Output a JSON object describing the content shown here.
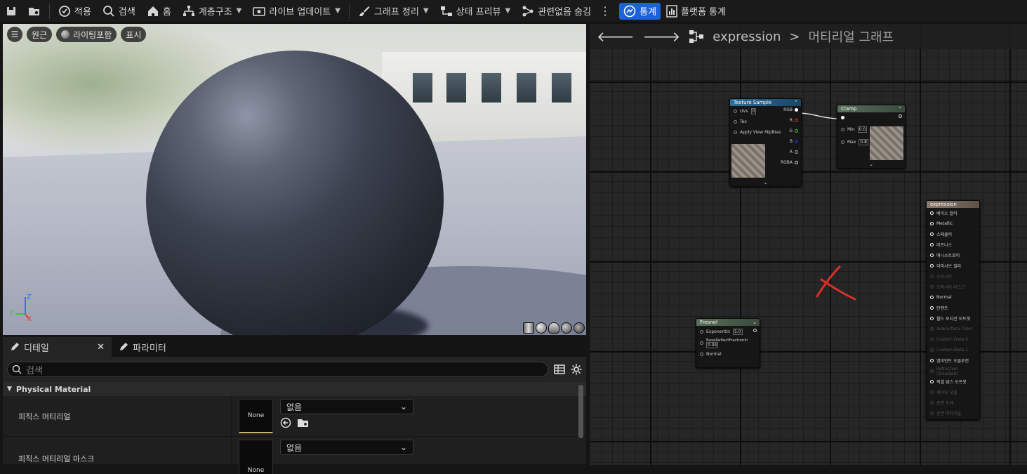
{
  "toolbar": {
    "apply": "적용",
    "search": "검색",
    "home": "홈",
    "hierarchy": "계층구조",
    "live_update": "라이브 업데이트",
    "graph_cleanup": "그래프 정리",
    "state_preview": "상태 프리뷰",
    "hide_unrelated": "관련없음 숨김",
    "stats": "통계",
    "platform_stats": "플랫폼 통계"
  },
  "viewport": {
    "perspective": "원근",
    "lighting": "라이팅포함",
    "show": "표시",
    "axis_z": "Z",
    "axis_y": "Y",
    "axis_x": "X"
  },
  "details": {
    "tab_details": "디테일",
    "tab_params": "파라미터",
    "search_placeholder": "검색",
    "section": "Physical Material",
    "rows": [
      {
        "label": "피직스 머티리얼",
        "thumb": "None",
        "value": "없음"
      },
      {
        "label": "피직스 머티리얼 마스크",
        "thumb": "None",
        "value": "없음"
      }
    ]
  },
  "graph": {
    "crumb_root": "expression",
    "crumb_sep": ">",
    "crumb_leaf": "머티리얼 그래프",
    "texture_sample": {
      "title": "Texture Sample",
      "inputs": [
        "UVs",
        "Tex",
        "Apply View MipBias"
      ],
      "uv_value": "0",
      "outputs": [
        "RGB",
        "R",
        "G",
        "B",
        "A",
        "RGBA"
      ]
    },
    "clamp": {
      "title": "Clamp",
      "min_label": "Min",
      "min_value": "0.0",
      "max_label": "Max",
      "max_value": "0.8"
    },
    "fresnel": {
      "title": "Fresnel",
      "exp_label": "ExponentIn",
      "exp_value": "5.0",
      "base_label": "BaseReflectFractionIn",
      "base_value": "0.04",
      "normal_label": "Normal"
    },
    "result": {
      "title": "expression",
      "pins": [
        {
          "label": "베이스 컬러",
          "active": true
        },
        {
          "label": "Metallic",
          "active": true
        },
        {
          "label": "스페큘러",
          "active": true
        },
        {
          "label": "러프니스",
          "active": true
        },
        {
          "label": "애니소트로피",
          "active": true
        },
        {
          "label": "이미시브 컬러",
          "active": true
        },
        {
          "label": "오파시티",
          "active": false
        },
        {
          "label": "오파시티 마스크",
          "active": false
        },
        {
          "label": "Normal",
          "active": true
        },
        {
          "label": "탄젠트",
          "active": true
        },
        {
          "label": "월드 포지션 오프셋",
          "active": true
        },
        {
          "label": "Subsurface Color",
          "active": false
        },
        {
          "label": "Custom Data 0",
          "active": false
        },
        {
          "label": "Custom Data 1",
          "active": false
        },
        {
          "label": "앰비언트 오클루전",
          "active": true
        },
        {
          "label": "Refraction (Disabled)",
          "active": false
        },
        {
          "label": "픽셀 뎁스 오프셋",
          "active": true
        },
        {
          "label": "셰이딩 모델",
          "active": false
        },
        {
          "label": "표면 두께",
          "active": false
        },
        {
          "label": "전면 머티리얼",
          "active": false
        }
      ]
    }
  },
  "colors": {
    "accent": "#1d63d8",
    "texture_header": "#2f6e9c",
    "clamp_header": "#56705a",
    "fresnel_header": "#56705a",
    "result_header": "#8a7a6b",
    "red_mark": "#d9302a"
  }
}
